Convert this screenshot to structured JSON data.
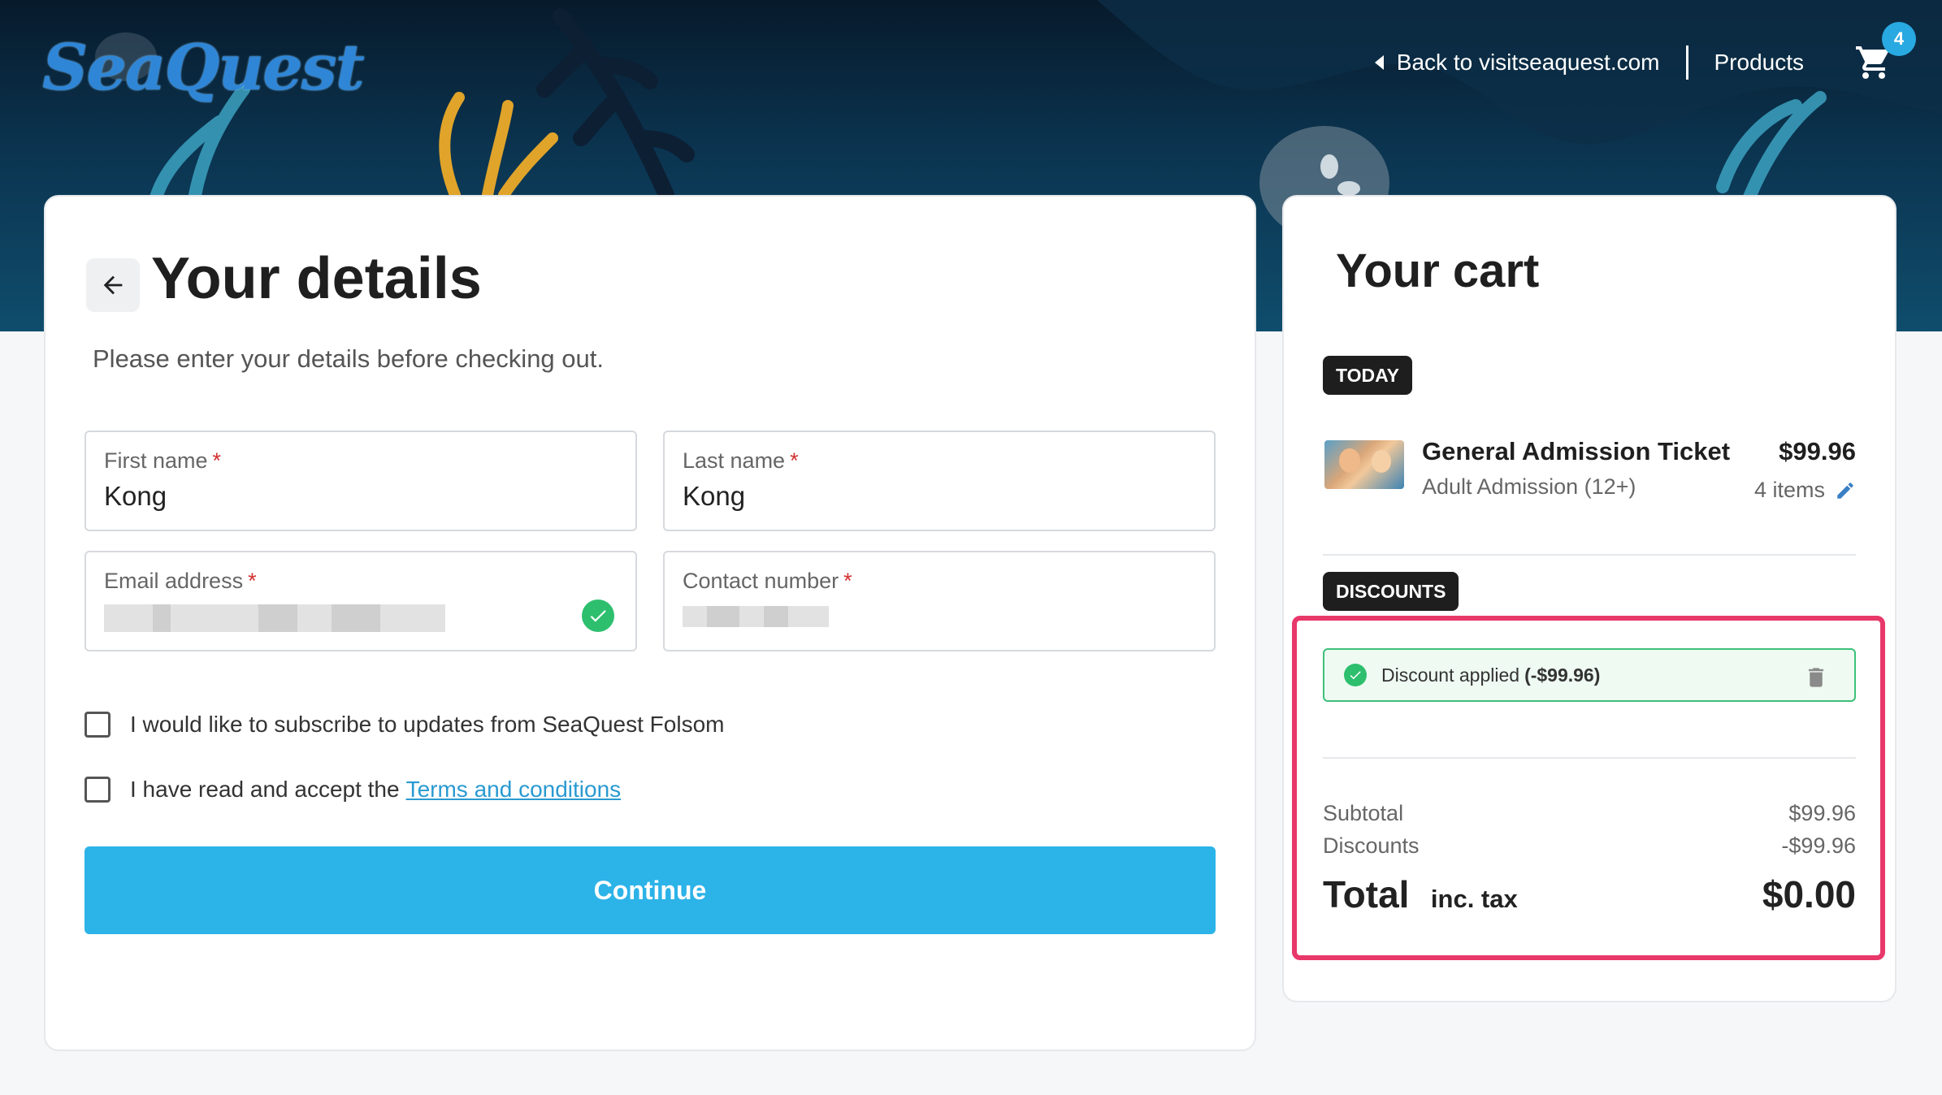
{
  "header": {
    "logo_text": "SeaQuest",
    "back_link": "Back to visitseaquest.com",
    "products_link": "Products",
    "cart_count": "4"
  },
  "details": {
    "title": "Your details",
    "subtitle": "Please enter your details before checking out.",
    "fields": {
      "first_name": {
        "label": "First name",
        "value": "Kong",
        "required": "*"
      },
      "last_name": {
        "label": "Last name",
        "value": "Kong",
        "required": "*"
      },
      "email": {
        "label": "Email address",
        "required": "*",
        "value_redacted": true,
        "valid": true
      },
      "contact": {
        "label": "Contact number",
        "required": "*",
        "value_redacted": true
      }
    },
    "subscribe_label": "I would like to subscribe to updates from SeaQuest Folsom",
    "terms_prefix": "I have read and accept the",
    "terms_link": "Terms and conditions",
    "continue_label": "Continue"
  },
  "cart": {
    "title": "Your cart",
    "today_tag": "TODAY",
    "item": {
      "name": "General Admission Ticket",
      "subtitle": "Adult Admission (12+)",
      "price": "$99.96",
      "quantity": "4 items"
    },
    "discounts_tag": "DISCOUNTS",
    "discount": {
      "label": "Discount applied",
      "amount": "(-$99.96)"
    },
    "subtotal_label": "Subtotal",
    "subtotal_value": "$99.96",
    "discounts_label": "Discounts",
    "discounts_value": "-$99.96",
    "total_label": "Total",
    "total_tax_label": "inc. tax",
    "total_value": "$0.00"
  },
  "colors": {
    "accent": "#2cb3e8",
    "success": "#2dbf6e",
    "highlight": "#e8386a",
    "required": "#d32f2f"
  },
  "icons": [
    "back-arrow-icon",
    "caret-left-icon",
    "cart-icon",
    "check-circle-icon",
    "pencil-icon",
    "trash-icon"
  ]
}
